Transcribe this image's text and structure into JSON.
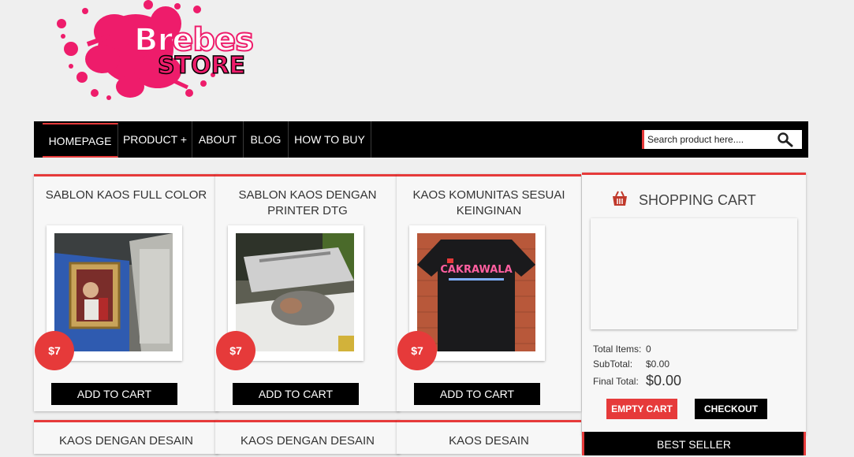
{
  "logo": {
    "line1": "Brebes",
    "line2": "STORE"
  },
  "nav": {
    "items": [
      {
        "label": "HOMEPAGE"
      },
      {
        "label": "PRODUCT +"
      },
      {
        "label": "ABOUT"
      },
      {
        "label": "BLOG"
      },
      {
        "label": "HOW TO BUY"
      }
    ],
    "search_placeholder": "Search product here...."
  },
  "products": [
    {
      "title": "SABLON KAOS FULL COLOR",
      "price": "$7",
      "button": "ADD TO CART"
    },
    {
      "title": "SABLON KAOS DENGAN PRINTER DTG",
      "price": "$7",
      "button": "ADD TO CART"
    },
    {
      "title": "KAOS KOMUNITAS SESUAI KEINGINAN",
      "price": "$7",
      "button": "ADD TO CART",
      "shirt_text": "CAKRAWALA"
    },
    {
      "title": "KAOS DENGAN DESAIN"
    },
    {
      "title": "KAOS DENGAN DESAIN"
    },
    {
      "title": "KAOS DESAIN"
    }
  ],
  "cart": {
    "title": "SHOPPING CART",
    "total_items_label": "Total Items:",
    "total_items_value": "0",
    "subtotal_label": "SubTotal:",
    "subtotal_value": "$0.00",
    "final_label": "Final Total:",
    "final_value": "$0.00",
    "empty_label": "EMPTY CART",
    "checkout_label": "CHECKOUT"
  },
  "bestseller": {
    "title": "BEST SELLER"
  },
  "colors": {
    "accent": "#e63a3a",
    "brand_pink": "#ee1c6b",
    "nav_bg": "#000000"
  }
}
